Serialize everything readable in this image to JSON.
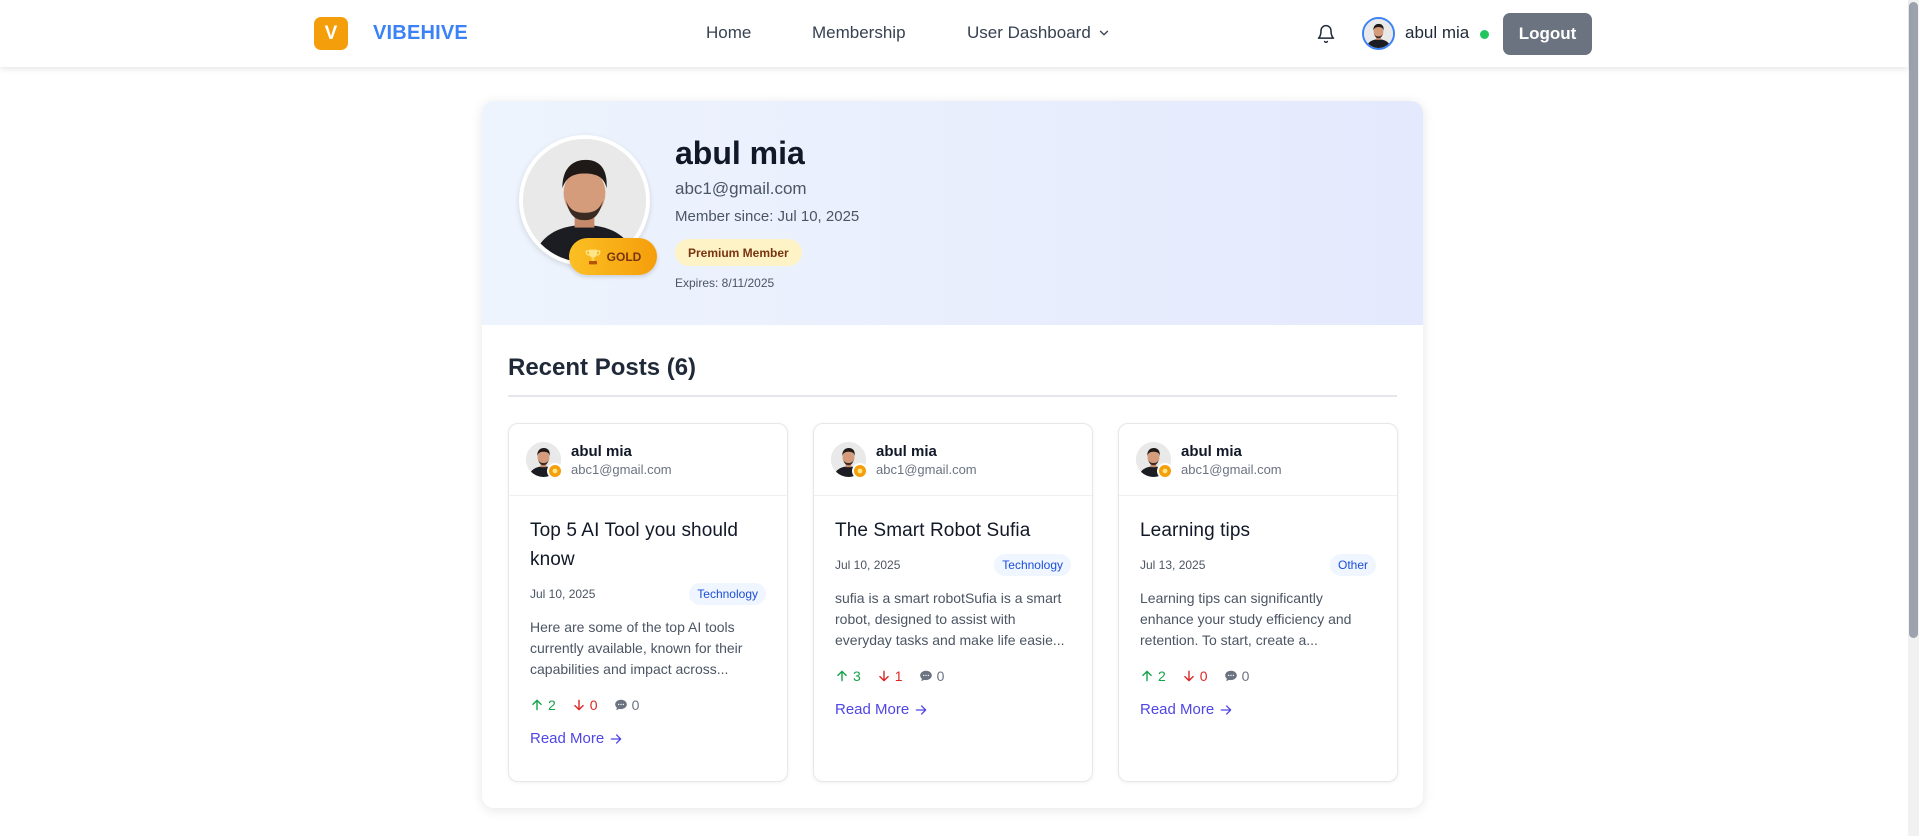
{
  "navbar": {
    "logo_letter": "V",
    "brand": "VIBEHIVE",
    "links": [
      "Home",
      "Membership",
      "User Dashboard"
    ],
    "user_name": "abul mia",
    "logout_label": "Logout"
  },
  "profile": {
    "name": "abul mia",
    "email": "abc1@gmail.com",
    "member_since": "Member since: Jul 10, 2025",
    "badge": "GOLD",
    "membership": "Premium Member",
    "expires": "Expires: 8/11/2025"
  },
  "recent_posts": {
    "heading": "Recent Posts (6)",
    "read_more": "Read More",
    "posts": [
      {
        "author": "abul mia",
        "email": "abc1@gmail.com",
        "title": "Top 5 AI Tool you should know",
        "date": "Jul 10, 2025",
        "tag": "Technology",
        "excerpt": "Here are some of the top AI tools currently available, known for their capabilities and impact across...",
        "upvotes": "2",
        "downvotes": "0",
        "comments": "0"
      },
      {
        "author": "abul mia",
        "email": "abc1@gmail.com",
        "title": "The Smart Robot Sufia",
        "date": "Jul 10, 2025",
        "tag": "Technology",
        "excerpt": "sufia is a smart robotSufia is a smart robot, designed to assist with everyday tasks and make life easie...",
        "upvotes": "3",
        "downvotes": "1",
        "comments": "0"
      },
      {
        "author": "abul mia",
        "email": "abc1@gmail.com",
        "title": "Learning tips",
        "date": "Jul 13, 2025",
        "tag": "Other",
        "excerpt": "Learning tips can significantly enhance your study efficiency and retention. To start, create a...",
        "upvotes": "2",
        "downvotes": "0",
        "comments": "0"
      }
    ]
  },
  "colors": {
    "brand": "#3b82f6",
    "logo": "#f59e0b",
    "gold": "#f59e0b",
    "link": "#4f46e5",
    "upvote": "#16a34a",
    "downvote": "#dc2626",
    "online": "#22c55e"
  }
}
